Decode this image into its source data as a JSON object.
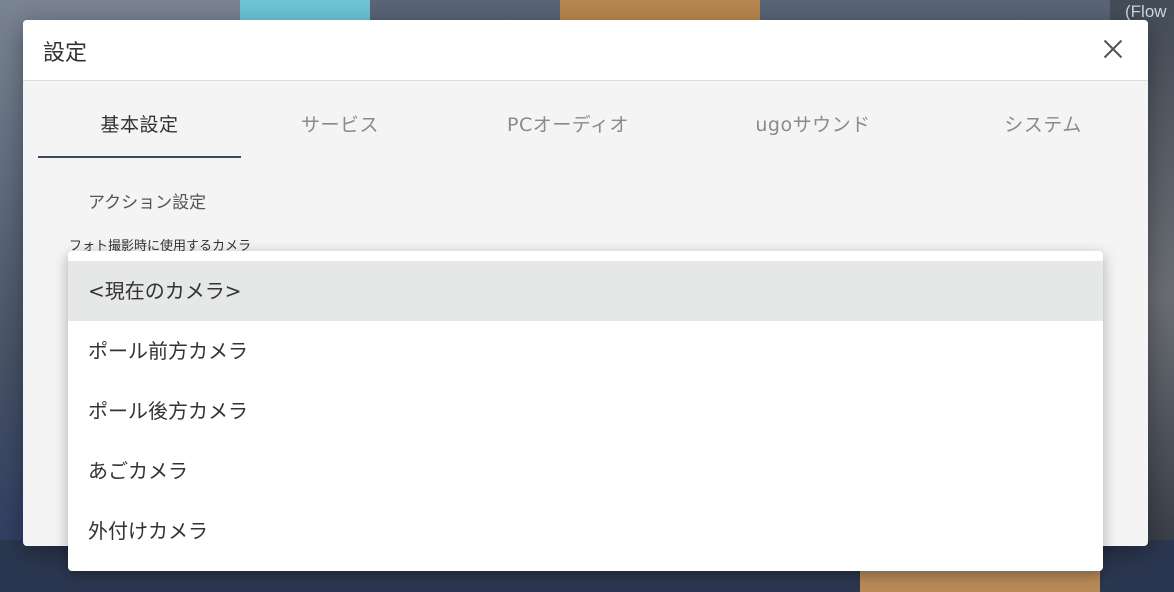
{
  "background": {
    "corner_text": "(Flow"
  },
  "dialog": {
    "title": "設定",
    "close_icon": "close-icon"
  },
  "tabs": [
    {
      "label": "基本設定",
      "active": true
    },
    {
      "label": "サービス",
      "active": false
    },
    {
      "label": "PCオーディオ",
      "active": false
    },
    {
      "label": "ugoサウンド",
      "active": false
    },
    {
      "label": "システム",
      "active": false
    }
  ],
  "section": {
    "title": "アクション設定",
    "field_label": "フォト撮影時に使用するカメラ"
  },
  "camera_dropdown": {
    "options": [
      {
        "label": "<現在のカメラ>",
        "selected": true
      },
      {
        "label": "ポール前方カメラ",
        "selected": false
      },
      {
        "label": "ポール後方カメラ",
        "selected": false
      },
      {
        "label": "あごカメラ",
        "selected": false
      },
      {
        "label": "外付けカメラ",
        "selected": false
      }
    ]
  },
  "colors": {
    "dialog_bg": "#f4f4f4",
    "active_tab_underline": "#3a4a5c",
    "selected_option_bg": "#e6e8e8"
  }
}
